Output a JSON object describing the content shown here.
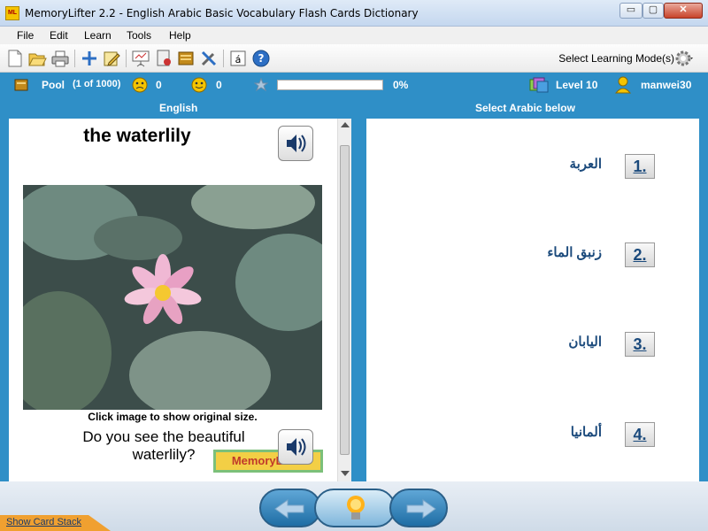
{
  "window": {
    "title": "MemoryLifter 2.2 - English Arabic Basic Vocabulary Flash Cards Dictionary",
    "app_icon_text": "ML",
    "min_label": "▭",
    "max_label": "▢",
    "close_label": "✕"
  },
  "menu": [
    "File",
    "Edit",
    "Learn",
    "Tools",
    "Help"
  ],
  "toolbar": {
    "learning_mode_label": "Select Learning Mode(s)"
  },
  "status": {
    "pool_label": "Pool",
    "pool_count": "(1 of 1000)",
    "wrong_count": "0",
    "right_count": "0",
    "progress_percent": "0%",
    "progress_value": 0,
    "level": "Level 10",
    "user": "manwei30"
  },
  "headers": {
    "left": "English",
    "right": "Select Arabic below"
  },
  "card": {
    "word": "the waterlily",
    "image_caption": "Click image to show original size.",
    "example_sentence": "Do you see the beautiful waterlily?",
    "logo_text": "MemoryLifter"
  },
  "answers": [
    {
      "number": "1.",
      "text": "العربة"
    },
    {
      "number": "2.",
      "text": "زنبق الماء"
    },
    {
      "number": "3.",
      "text": "اليابان"
    },
    {
      "number": "4.",
      "text": "ألمانيا"
    }
  ],
  "bottom": {
    "show_card_stack": "Show Card Stack"
  },
  "colors": {
    "accent": "#2f8fc7",
    "answer_text": "#1b4a7c"
  },
  "icons": [
    "new-icon",
    "open-icon",
    "print-icon",
    "add-card-icon",
    "edit-icon",
    "presentation-icon",
    "dictionary-icon",
    "book-icon",
    "tools-icon",
    "char-map-icon",
    "help-icon",
    "gear-icon",
    "smiley-sad-icon",
    "smiley-happy-icon",
    "star-icon",
    "level-icon",
    "user-icon",
    "speaker-icon",
    "arrow-left-icon",
    "lightbulb-icon",
    "arrow-right-icon"
  ]
}
